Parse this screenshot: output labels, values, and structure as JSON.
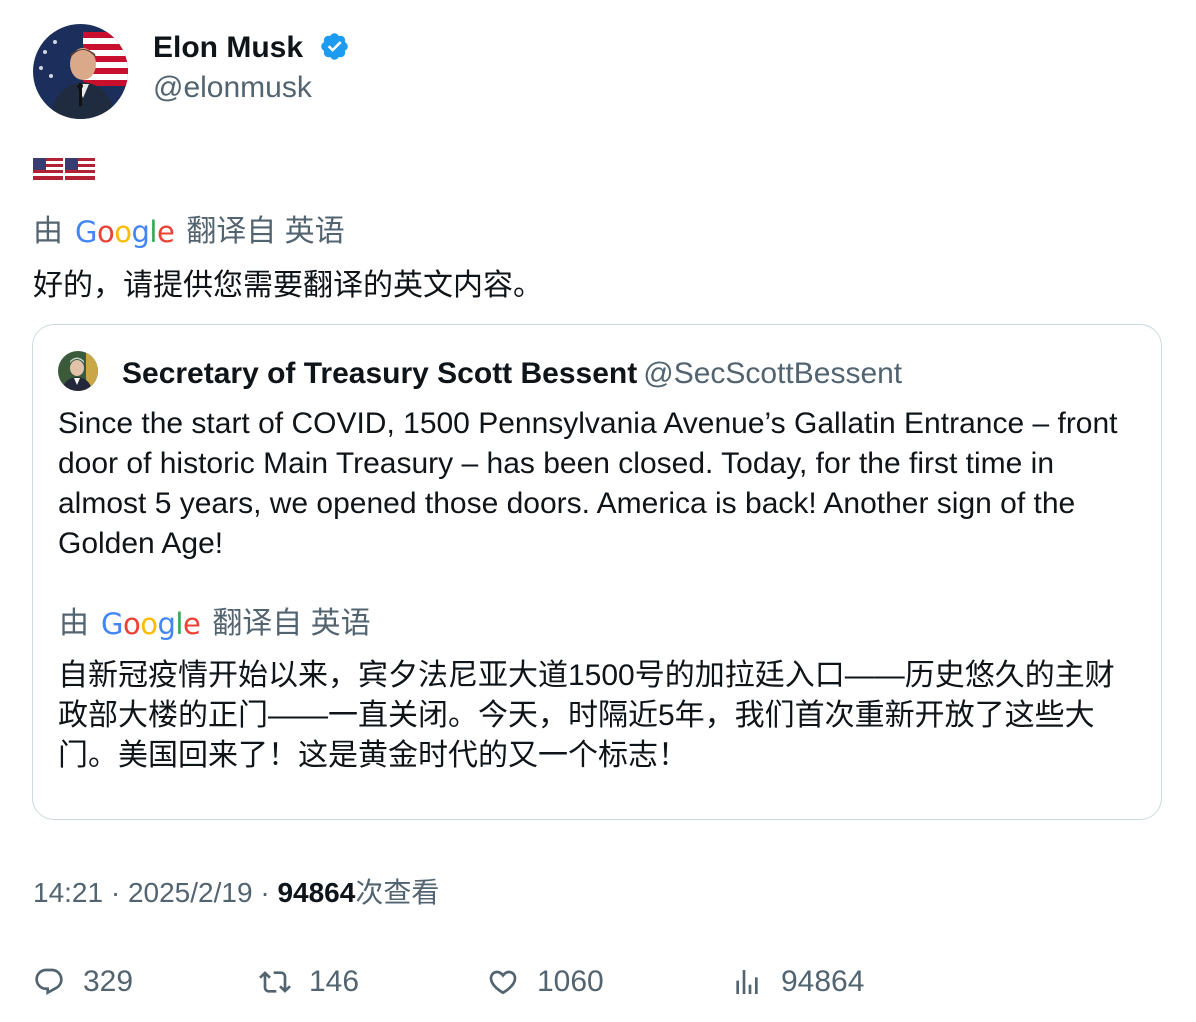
{
  "author": {
    "name": "Elon Musk",
    "handle": "@elonmusk",
    "verified_icon": "verified-badge-icon",
    "accent": "#1d9bf0"
  },
  "tweet": {
    "text": "🇺🇸🇺🇸"
  },
  "translation_banner": {
    "prefix": "由",
    "provider": "Google",
    "suffix": "翻译自 英语"
  },
  "translated_text": "好的，请提供您需要翻译的英文内容。",
  "quoted": {
    "name": "Secretary of Treasury Scott Bessent",
    "handle": "@SecScottBessent",
    "text": "Since the start of COVID, 1500 Pennsylvania Avenue’s Gallatin Entrance – front door of historic Main Treasury – has been closed. Today, for the first time in almost 5 years, we opened those doors. America is back! Another sign of the Golden Age!",
    "translation_banner": {
      "prefix": "由",
      "provider": "Google",
      "suffix": "翻译自 英语"
    },
    "translated_text": "自新冠疫情开始以来，宾夕法尼亚大道1500号的加拉廷入口——历史悠久的主财政部大楼的正门——一直关闭。今天，时隔近5年，我们首次重新开放了这些大门。美国回来了！这是黄金时代的又一个标志！"
  },
  "meta": {
    "time": "14:21",
    "sep1": " · ",
    "date": "2025/2/19",
    "sep2": " · ",
    "views": "94864",
    "views_suffix": "次查看"
  },
  "actions": {
    "reply_count": "329",
    "retweet_count": "146",
    "like_count": "1060",
    "view_count": "94864"
  }
}
